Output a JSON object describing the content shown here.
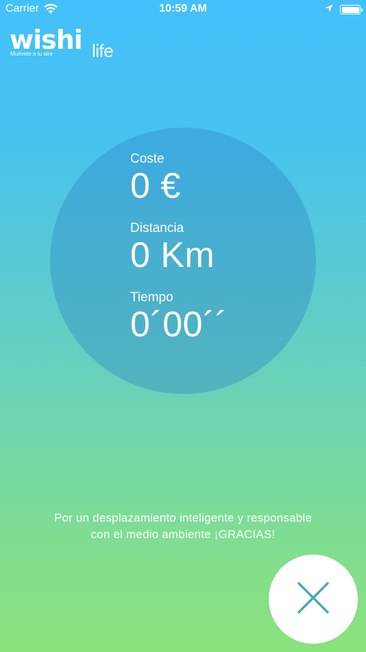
{
  "status_bar": {
    "carrier": "Carrier",
    "time": "10:59 AM",
    "icons": [
      "wifi-icon",
      "location-arrow-icon",
      "battery-icon"
    ]
  },
  "logo": {
    "word": "wishi",
    "sub": "life",
    "tagline": "Muévete a tu aire"
  },
  "stats": {
    "cost": {
      "label": "Coste",
      "value": "0 €"
    },
    "distance": {
      "label": "Distancia",
      "value": "0 Km"
    },
    "time": {
      "label": "Tiempo",
      "value": "0´00´´"
    }
  },
  "message": {
    "line1": "Por un desplazamiento inteligente y responsable",
    "line2": "con el medio ambiente ¡GRACIAS!"
  },
  "close_button": {
    "icon": "close-icon"
  },
  "colors": {
    "gradient_top": "#43c0fb",
    "gradient_bottom": "#8ae27c",
    "circle": "#3f98d4",
    "close_icon": "#4aaab9"
  }
}
